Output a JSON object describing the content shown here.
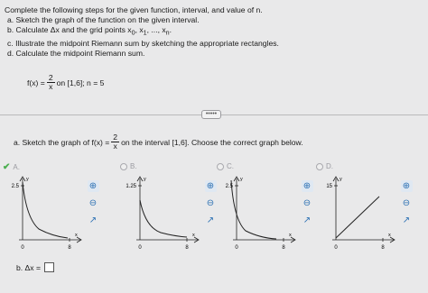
{
  "intro": "Complete the following steps for the given function, interval, and value of n.",
  "steps": {
    "a": "a. Sketch the graph of the function on the given interval.",
    "b": "b. Calculate Δx and the grid points x",
    "b_sub0": "0",
    "b_mid": ", x",
    "b_sub1": "1",
    "b_dots": ", ..., x",
    "b_subn": "n",
    "b_end": ".",
    "c": "c. Illustrate the midpoint Riemann sum by sketching the appropriate rectangles.",
    "d": "d. Calculate the midpoint Riemann sum."
  },
  "function": {
    "lhs": "f(x) =",
    "num": "2",
    "den": "x",
    "rest": "on [1,6]; n = 5"
  },
  "more_button": "•••••",
  "question": {
    "prefix": "a. Sketch the graph of f(x) =",
    "num": "2",
    "den": "x",
    "suffix": "on the interval [1,6]. Choose the correct graph below."
  },
  "options": [
    {
      "letter": "A.",
      "selected": true,
      "ytick": "2.5",
      "xtick0": "0",
      "xtick1": "8",
      "xlabel": "x",
      "ylabel": "y",
      "curve": "decreasing"
    },
    {
      "letter": "B.",
      "selected": false,
      "ytick": "1.25",
      "xtick0": "0",
      "xtick1": "8",
      "xlabel": "x",
      "ylabel": "y",
      "curve": "decreasing-low"
    },
    {
      "letter": "C.",
      "selected": false,
      "ytick": "2.5",
      "xtick0": "0",
      "xtick1": "8",
      "xlabel": "x",
      "ylabel": "y",
      "curve": "decreasing-steep"
    },
    {
      "letter": "D.",
      "selected": false,
      "ytick": "15",
      "xtick0": "0",
      "xtick1": "8",
      "xlabel": "x",
      "ylabel": "y",
      "curve": "increasing-line"
    }
  ],
  "icons": {
    "check": "✔",
    "zoom_in": "zoom-in-icon",
    "zoom_out": "zoom-out-icon",
    "popout": "popout-icon"
  },
  "answer": {
    "label": "b. Δx ="
  },
  "colors": {
    "accent": "#2a6fb3",
    "check": "#4caf50",
    "background": "#e9e9ea"
  }
}
